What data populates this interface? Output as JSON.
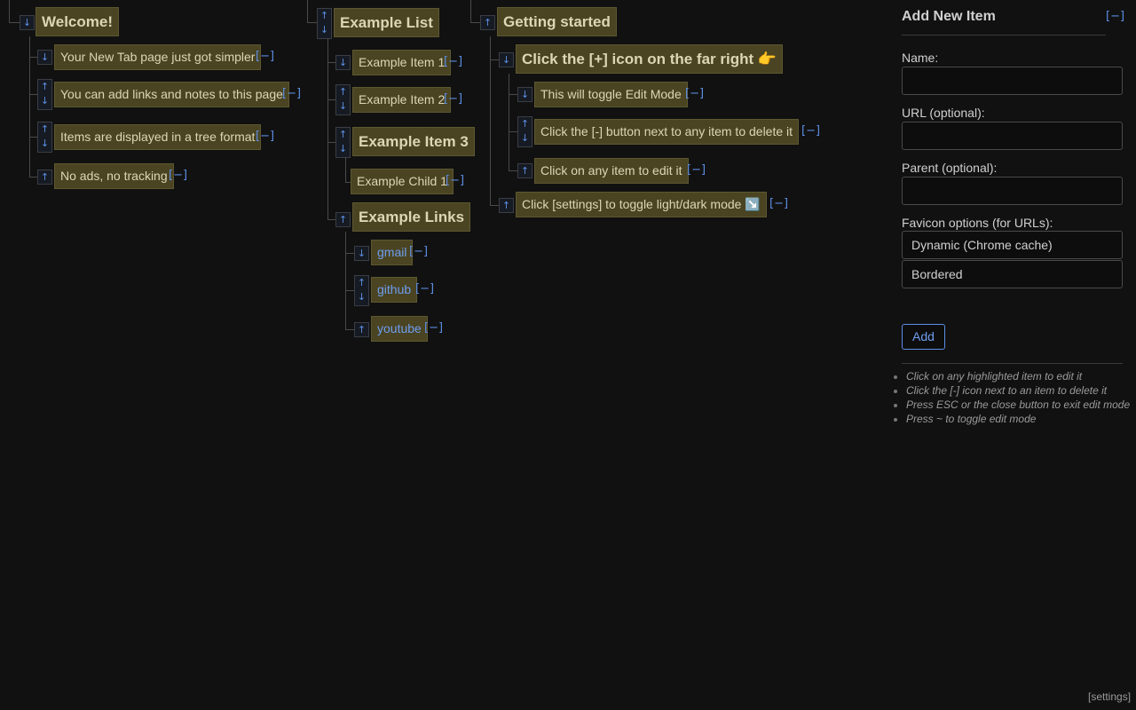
{
  "col1": {
    "title": "Welcome!",
    "items": [
      "Your New Tab page just got simpler",
      "You can add links and notes to this page",
      "Items are displayed in a tree format",
      "No ads, no tracking"
    ]
  },
  "col2": {
    "title": "Example List",
    "items": [
      "Example Item 1",
      "Example Item 2",
      "Example Item 3",
      "Example Child 1",
      "Example Links"
    ],
    "links": [
      "gmail",
      "github",
      "youtube"
    ]
  },
  "col3": {
    "title": "Getting started",
    "items": [
      "Click the [+] icon on the far right 👉",
      "This will toggle Edit Mode",
      "Click the [-] button next to any item to delete it",
      "Click on any item to edit it",
      "Click [settings] to toggle light/dark mode ↘️"
    ]
  },
  "controls": {
    "up": "↑",
    "down": "↓",
    "delete": "[−]"
  },
  "panel": {
    "title": "Add New Item",
    "close": "[−]",
    "name_label": "Name:",
    "name_value": "",
    "url_label": "URL (optional):",
    "url_value": "",
    "parent_label": "Parent (optional):",
    "parent_value": "",
    "favicon_label": "Favicon options (for URLs):",
    "favicon_source": "Dynamic (Chrome cache)",
    "favicon_style": "Bordered",
    "add_button": "Add",
    "tips": [
      "Click on any highlighted item to edit it",
      "Click the [-] icon next to an item to delete it",
      "Press ESC or the close button to exit edit mode",
      "Press ~ to toggle edit mode"
    ]
  },
  "settings": "[settings]"
}
